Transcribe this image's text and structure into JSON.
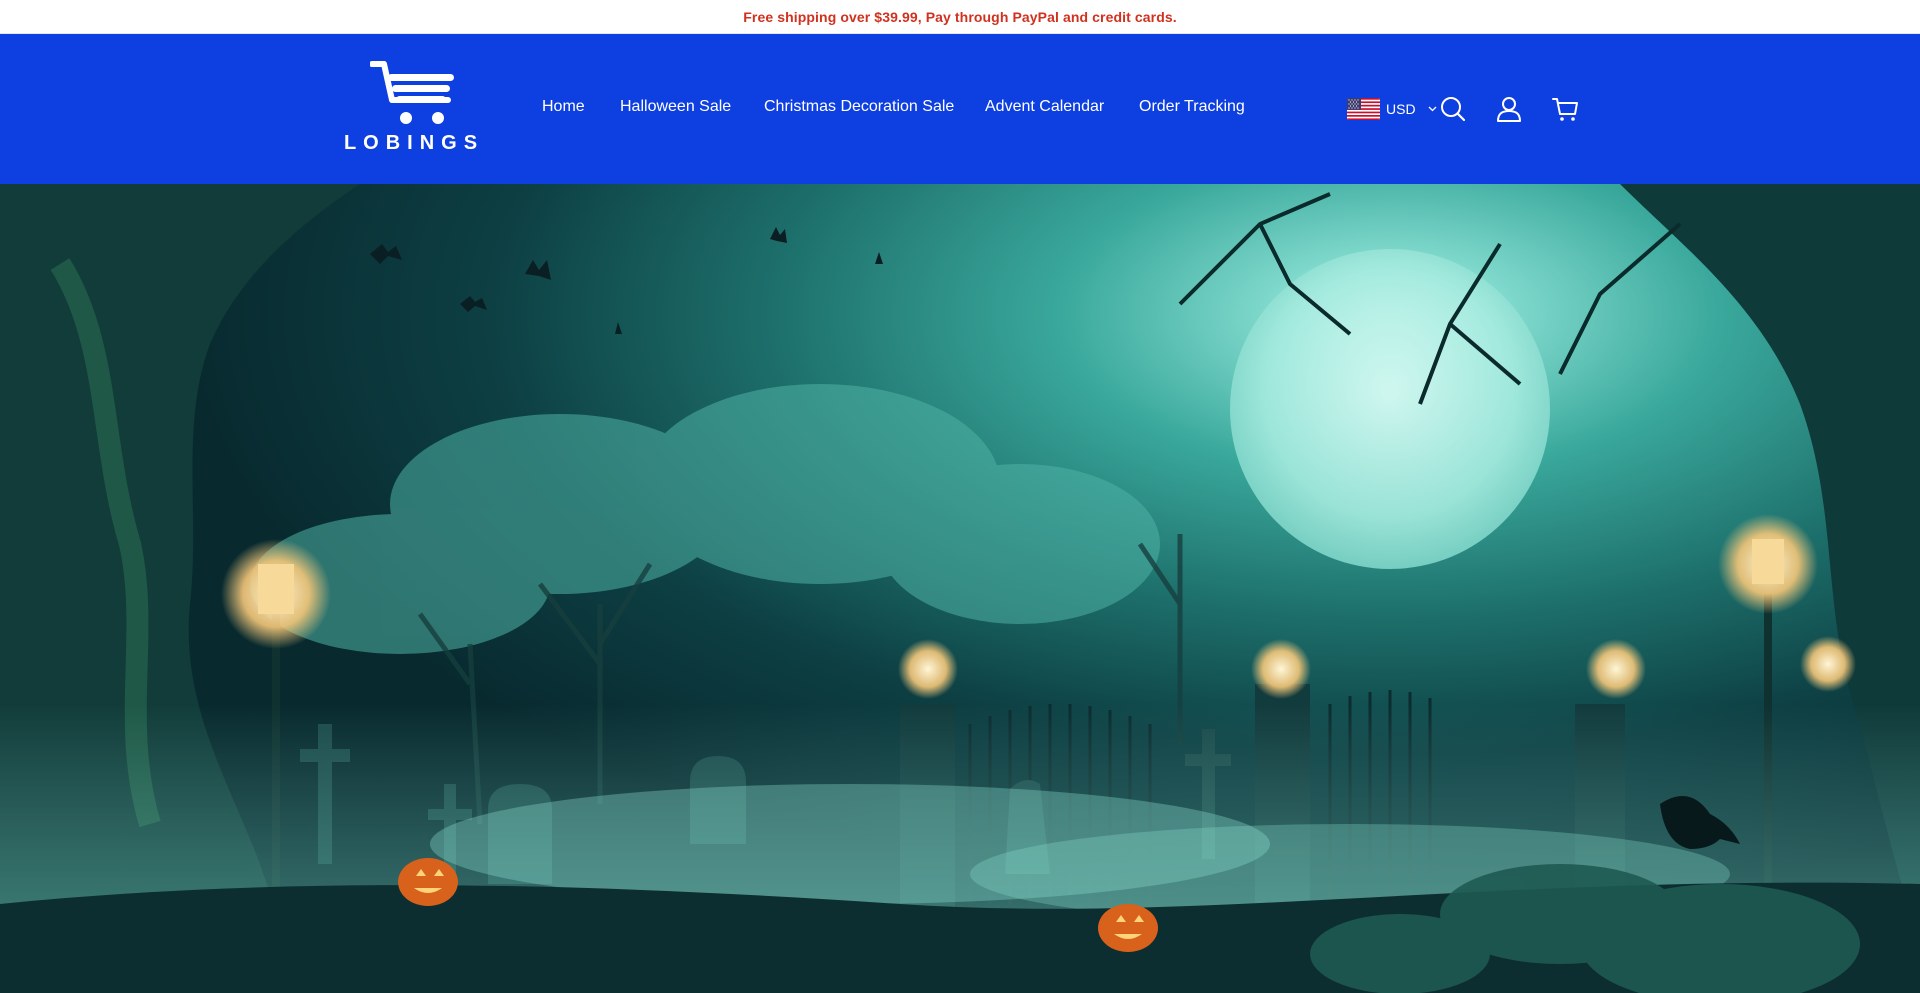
{
  "announcement": {
    "text": "Free shipping over $39.99, Pay through PayPal and credit cards."
  },
  "header": {
    "logo_text": "LOBINGS",
    "nav": [
      {
        "label": "Home"
      },
      {
        "label": "Halloween Sale"
      },
      {
        "label": "Christmas Decoration Sale"
      },
      {
        "label": "Advent Calendar"
      },
      {
        "label": "Order Tracking"
      }
    ],
    "currency": {
      "code": "USD",
      "flag_icon": "us-flag-icon"
    },
    "icons": [
      "search-icon",
      "account-icon",
      "cart-icon"
    ]
  },
  "colors": {
    "header_bg": "#0e3fe0",
    "announcement_text": "#d0321f"
  },
  "hero": {
    "image_subject": "Halloween graveyard scene with full moon, bats, lanterns, gates and jack-o-lanterns"
  }
}
